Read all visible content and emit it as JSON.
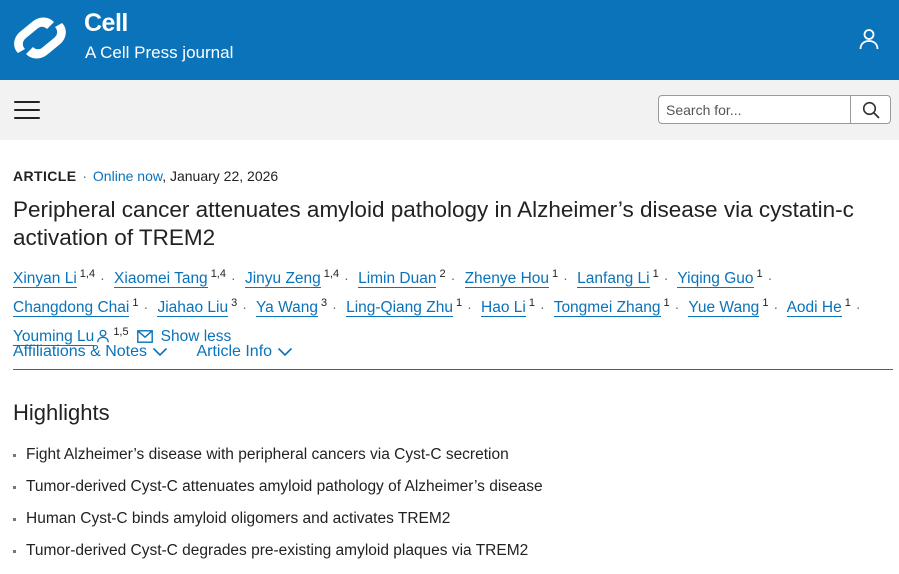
{
  "header": {
    "brand_title": "Cell",
    "brand_subtitle": "A Cell Press journal",
    "bg_color": "#0a73b9",
    "user_icon": "person-icon"
  },
  "nav": {
    "menu_icon": "hamburger-menu-icon",
    "search_placeholder": "Search for...",
    "search_icon": "search-icon"
  },
  "article": {
    "type": "ARTICLE",
    "separator": "·",
    "status": "Online now",
    "date": ", January 22, 2026",
    "title": "Peripheral cancer attenuates amyloid pathology in Alzheimer’s disease via cystatin-c activation of TREM2",
    "authors": [
      {
        "name": "Xinyan Li",
        "aff": "1,4"
      },
      {
        "name": "Xiaomei Tang",
        "aff": "1,4"
      },
      {
        "name": "Jinyu Zeng",
        "aff": "1,4"
      },
      {
        "name": "Limin Duan",
        "aff": "2"
      },
      {
        "name": "Zhenye Hou",
        "aff": "1"
      },
      {
        "name": "Lanfang Li",
        "aff": "1"
      },
      {
        "name": "Yiqing Guo",
        "aff": "1"
      },
      {
        "name": "Changdong Chai",
        "aff": "1"
      },
      {
        "name": "Jiahao Liu",
        "aff": "3"
      },
      {
        "name": "Ya Wang",
        "aff": "3"
      },
      {
        "name": "Ling-Qiang Zhu",
        "aff": "1"
      },
      {
        "name": "Hao Li",
        "aff": "1"
      },
      {
        "name": "Tongmei Zhang",
        "aff": "1"
      },
      {
        "name": "Yue Wang",
        "aff": "1"
      },
      {
        "name": "Aodi He",
        "aff": "1"
      },
      {
        "name": "Youming Lu",
        "aff": "1,5"
      }
    ],
    "show_less": "Show less",
    "tabs": [
      {
        "label": "Affiliations & Notes"
      },
      {
        "label": "Article Info"
      }
    ]
  },
  "highlights": {
    "heading": "Highlights",
    "items": [
      "Fight Alzheimer’s disease with peripheral cancers via Cyst-C secretion",
      "Tumor-derived Cyst-C attenuates amyloid pathology of Alzheimer’s disease",
      "Human Cyst-C binds amyloid oligomers and activates TREM2",
      "Tumor-derived Cyst-C degrades pre-existing amyloid plaques via TREM2"
    ]
  }
}
